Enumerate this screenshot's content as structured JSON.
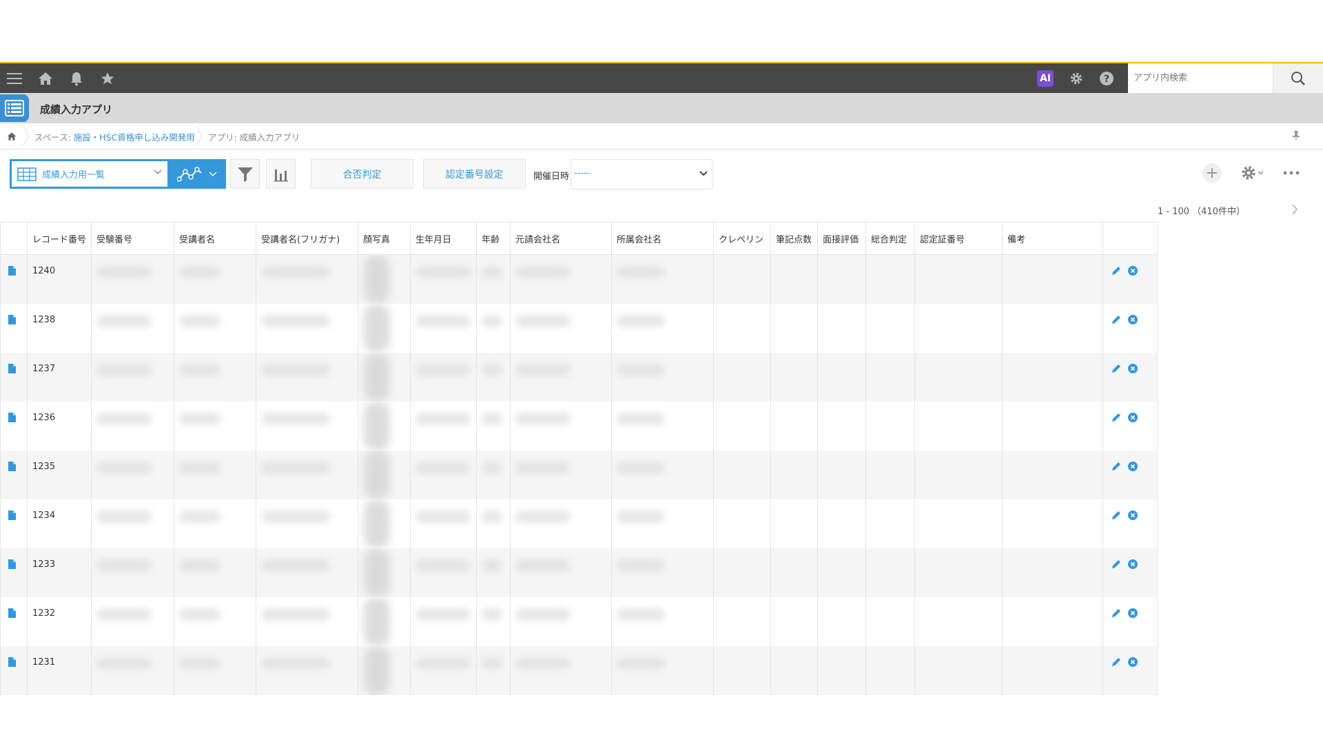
{
  "header": {
    "ai_badge": "AI",
    "search_placeholder": "アプリ内検索"
  },
  "app": {
    "title": "成績入力アプリ"
  },
  "breadcrumb": {
    "space_prefix": "スペース: ",
    "space_name": "施設・HSC資格申し込み開発用",
    "app_crumb": "アプリ: 成績入力アプリ"
  },
  "toolbar": {
    "view_label": "成績入力用一覧",
    "pass_judge_label": "合否判定",
    "cert_number_label": "認定番号設定",
    "date_label": "開催日時",
    "date_value": "-----",
    "pagination": "1 - 100 （410件中）"
  },
  "table": {
    "columns": [
      "レコード番号",
      "受験番号",
      "受講者名",
      "受講者名(フリガナ)",
      "顔写真",
      "生年月日",
      "年齢",
      "元請会社名",
      "所属会社名",
      "クレペリン",
      "筆記点数",
      "面接評価",
      "総合判定",
      "認定証番号",
      "備考"
    ],
    "rows": [
      {
        "record": "1240"
      },
      {
        "record": "1238"
      },
      {
        "record": "1237"
      },
      {
        "record": "1236"
      },
      {
        "record": "1235"
      },
      {
        "record": "1234"
      },
      {
        "record": "1233"
      },
      {
        "record": "1232"
      },
      {
        "record": "1231"
      }
    ]
  },
  "colors": {
    "accent": "#3498db",
    "header_bg": "#474747",
    "header_border": "#f5b800",
    "appbar_bg": "#d9d9d9",
    "ai_badge": "#7b4fd6"
  },
  "icons": [
    "menu-icon",
    "home-icon",
    "bell-icon",
    "star-icon",
    "gear-icon",
    "help-icon",
    "search-icon",
    "list-app-icon",
    "pin-icon",
    "table-view-icon",
    "graph-icon",
    "filter-icon",
    "bar-chart-icon",
    "plus-icon",
    "more-icon",
    "record-doc-icon",
    "edit-icon",
    "delete-icon"
  ]
}
